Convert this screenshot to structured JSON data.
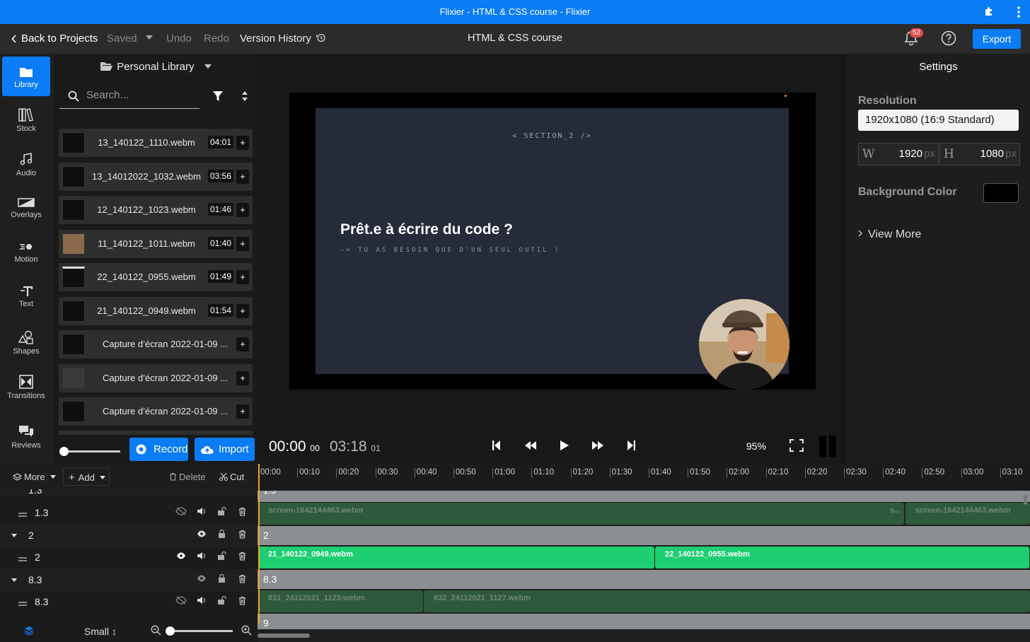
{
  "titlebar": {
    "title": "Flixier - HTML & CSS course - Flixier"
  },
  "topbar": {
    "back": "Back to Projects",
    "saved": "Saved",
    "undo": "Undo",
    "redo": "Redo",
    "version_history": "Version History",
    "project_title": "HTML & CSS course",
    "notifications": "52",
    "export": "Export"
  },
  "nav": [
    {
      "label": "Library",
      "icon": "folder-icon"
    },
    {
      "label": "Stock",
      "icon": "books-icon"
    },
    {
      "label": "Audio",
      "icon": "music-note-icon"
    },
    {
      "label": "Overlays",
      "icon": "overlay-icon"
    },
    {
      "label": "Motion",
      "icon": "motion-icon"
    },
    {
      "label": "Text",
      "icon": "text-icon"
    },
    {
      "label": "Shapes",
      "icon": "shapes-icon"
    },
    {
      "label": "Transitions",
      "icon": "transition-icon"
    },
    {
      "label": "Reviews",
      "icon": "chat-icon"
    }
  ],
  "library": {
    "header": "Personal Library",
    "search_placeholder": "Search...",
    "items": [
      {
        "name": "13_140122_1110.webm",
        "duration": "04:01"
      },
      {
        "name": "13_14012022_1032.webm",
        "duration": "03:56"
      },
      {
        "name": "12_140122_1023.webm",
        "duration": "01:46"
      },
      {
        "name": "11_140122_1011.webm",
        "duration": "01:40"
      },
      {
        "name": "22_140122_0955.webm",
        "duration": "01:49"
      },
      {
        "name": "21_140122_0949.webm",
        "duration": "01:54"
      },
      {
        "name": "Capture d’écran 2022-01-09 ...",
        "duration": ""
      },
      {
        "name": "Capture d’écran 2022-01-09 ...",
        "duration": ""
      },
      {
        "name": "Capture d’écran 2022-01-09 ...",
        "duration": ""
      }
    ],
    "record": "Record",
    "import": "Import"
  },
  "preview": {
    "section_label": "< SECTION_2 />",
    "headline": "Prêt.e à écrire du code ?",
    "subline": "-> TU AS BESOIN QUE D'UN SEUL OUTIL !",
    "current_time": "00:00",
    "current_frames": "00",
    "total_time": "03:18",
    "total_frames": "01",
    "zoom": "95%"
  },
  "settings": {
    "header": "Settings",
    "resolution_label": "Resolution",
    "resolution_value": "1920x1080 (16:9 Standard)",
    "width_label": "W",
    "width": "1920",
    "height_label": "H",
    "height": "1080",
    "unit": "px",
    "bg_label": "Background Color",
    "bg_color": "#000000",
    "view_more": "View More"
  },
  "timeline": {
    "more": "More",
    "add": "Add",
    "delete": "Delete",
    "cut": "Cut",
    "size": "Small",
    "ruler": [
      "00:00",
      "00:10",
      "00:20",
      "00:30",
      "00:40",
      "00:50",
      "01:00",
      "01:10",
      "01:20",
      "01:30",
      "01:40",
      "01:50",
      "02:00",
      "02:10",
      "02:20",
      "02:30",
      "02:40",
      "02:50",
      "03:00",
      "03:10"
    ],
    "tracks": [
      {
        "name": "1.3",
        "type": "group"
      },
      {
        "name": "1.3",
        "type": "track"
      },
      {
        "name": "2",
        "type": "group"
      },
      {
        "name": "2",
        "type": "track"
      },
      {
        "name": "8.3",
        "type": "group"
      },
      {
        "name": "8.3",
        "type": "track"
      },
      {
        "name": "9",
        "type": "group"
      }
    ],
    "clips": {
      "track_1_3": [
        "screen-1642144463.webm",
        "s...",
        "screen-1642144463.webm"
      ],
      "track_2": [
        "21_140122_0949.webm",
        "22_140122_0955.webm"
      ],
      "track_8_3": [
        "831_24112021_1123.webm",
        "832_24112021_1127.webm"
      ]
    }
  },
  "colors": {
    "accent": "#0a7cf5",
    "clip_active": "#1dcf71",
    "clip_dim": "#2e5a3c",
    "playhead": "#f1a52a"
  }
}
